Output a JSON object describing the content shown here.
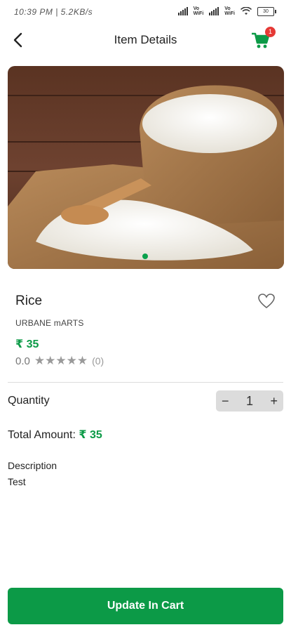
{
  "status_bar": {
    "time_speed": "10:39 PM | 5.2KB/s",
    "battery": "30"
  },
  "header": {
    "title": "Item Details",
    "cart_count": "1"
  },
  "product": {
    "name": "Rice",
    "store": "URBANE mARTS",
    "price": "₹ 35",
    "rating": "0.0",
    "rating_count": "(0)",
    "stars": "★★★★★"
  },
  "quantity": {
    "label": "Quantity",
    "minus": "−",
    "value": "1",
    "plus": "+"
  },
  "total": {
    "label": "Total Amount:",
    "value": "₹ 35"
  },
  "description": {
    "label": "Description",
    "text": "Test"
  },
  "actions": {
    "update_label": "Update In Cart"
  },
  "colors": {
    "accent": "#0c9a47",
    "badge": "#e53935"
  }
}
